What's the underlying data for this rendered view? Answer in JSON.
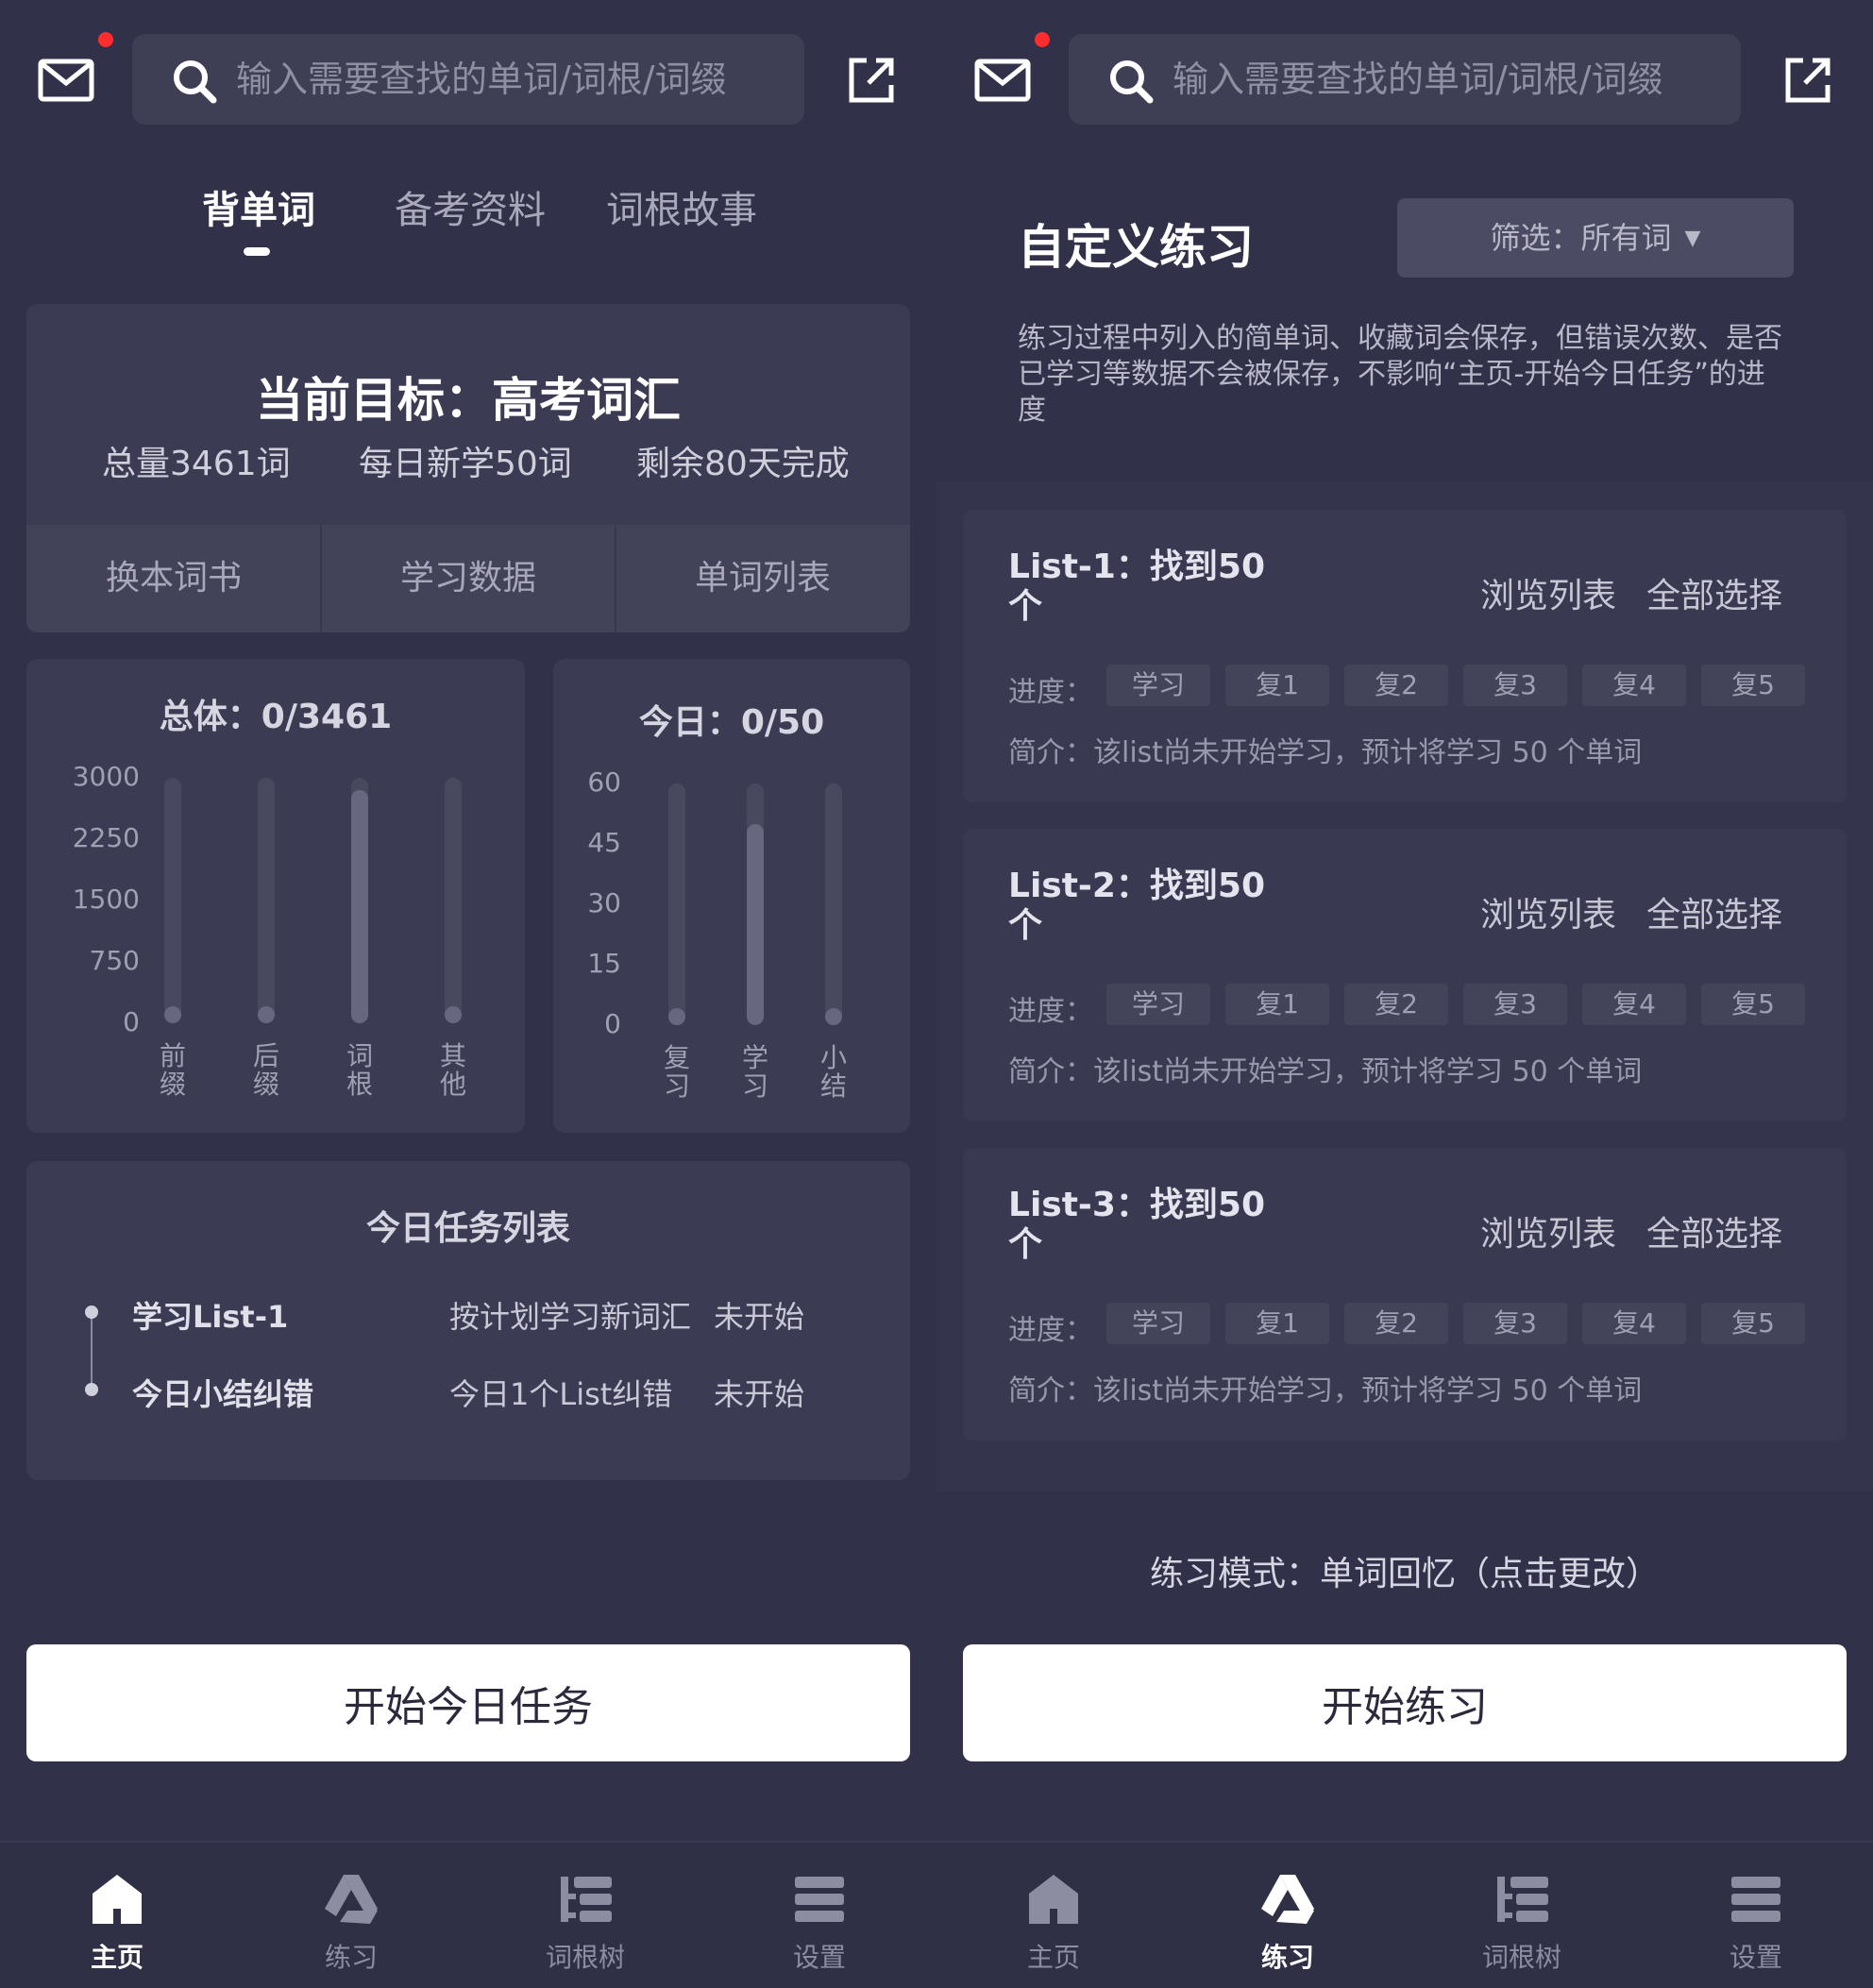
{
  "search": {
    "placeholder": "输入需要查找的单词/词根/词缀"
  },
  "home": {
    "tabs": [
      "背单词",
      "备考资料",
      "词根故事"
    ],
    "goal": {
      "title": "当前目标：高考词汇",
      "total": "总量3461词",
      "daily": "每日新学50词",
      "remaining": "剩余80天完成",
      "actions": [
        "换本词书",
        "学习数据",
        "单词列表"
      ]
    },
    "tasks": {
      "title": "今日任务列表",
      "items": [
        {
          "name": "学习List-1",
          "desc": "按计划学习新词汇",
          "status": "未开始"
        },
        {
          "name": "今日小结纠错",
          "desc": "今日1个List纠错",
          "status": "未开始"
        }
      ]
    },
    "start_button": "开始今日任务"
  },
  "chart_data": [
    {
      "type": "bar",
      "title": "总体：0/3461",
      "categories": [
        "前缀",
        "后缀",
        "词根",
        "其他"
      ],
      "yticks": [
        "3000",
        "2250",
        "1500",
        "750",
        "0"
      ],
      "ylim": [
        0,
        3000
      ],
      "track_values": [
        3000,
        3000,
        3000,
        3000
      ],
      "values": [
        200,
        200,
        2850,
        200
      ]
    },
    {
      "type": "bar",
      "title": "今日：0/50",
      "categories": [
        "复习",
        "学习",
        "小结"
      ],
      "yticks": [
        "60",
        "45",
        "30",
        "15",
        "0"
      ],
      "ylim": [
        0,
        60
      ],
      "track_values": [
        60,
        60,
        60
      ],
      "values": [
        0,
        50,
        0
      ]
    }
  ],
  "practice": {
    "title": "自定义练习",
    "filter": "筛选：所有词",
    "note": "练习过程中列入的简单词、收藏词会保存，但错误次数、是否已学习等数据不会被保存，不影响“主页-开始今日任务”的进度",
    "lists": [
      {
        "name": "List-1：找到50个",
        "browse": "浏览列表",
        "select": "全部选择",
        "progress_label": "进度：",
        "stages": [
          "学习",
          "复1",
          "复2",
          "复3",
          "复4",
          "复5"
        ],
        "intro": "简介：该list尚未开始学习，预计将学习 50 个单词"
      },
      {
        "name": "List-2：找到50个",
        "browse": "浏览列表",
        "select": "全部选择",
        "progress_label": "进度：",
        "stages": [
          "学习",
          "复1",
          "复2",
          "复3",
          "复4",
          "复5"
        ],
        "intro": "简介：该list尚未开始学习，预计将学习 50 个单词"
      },
      {
        "name": "List-3：找到50个",
        "browse": "浏览列表",
        "select": "全部选择",
        "progress_label": "进度：",
        "stages": [
          "学习",
          "复1",
          "复2",
          "复3",
          "复4",
          "复5"
        ],
        "intro": "简介：该list尚未开始学习，预计将学习 50 个单词"
      }
    ],
    "mode": "练习模式：单词回忆（点击更改）",
    "start_button": "开始练习"
  },
  "nav": {
    "items": [
      {
        "label": "主页",
        "icon": "home-icon"
      },
      {
        "label": "练习",
        "icon": "practice-icon"
      },
      {
        "label": "词根树",
        "icon": "root-tree-icon"
      },
      {
        "label": "设置",
        "icon": "settings-icon"
      }
    ],
    "left_active": 0,
    "right_active": 1
  },
  "colors": {
    "background": "#31314a",
    "card": "#3b3b53",
    "accent": "#ffffff",
    "badge": "#ff2d2d"
  }
}
